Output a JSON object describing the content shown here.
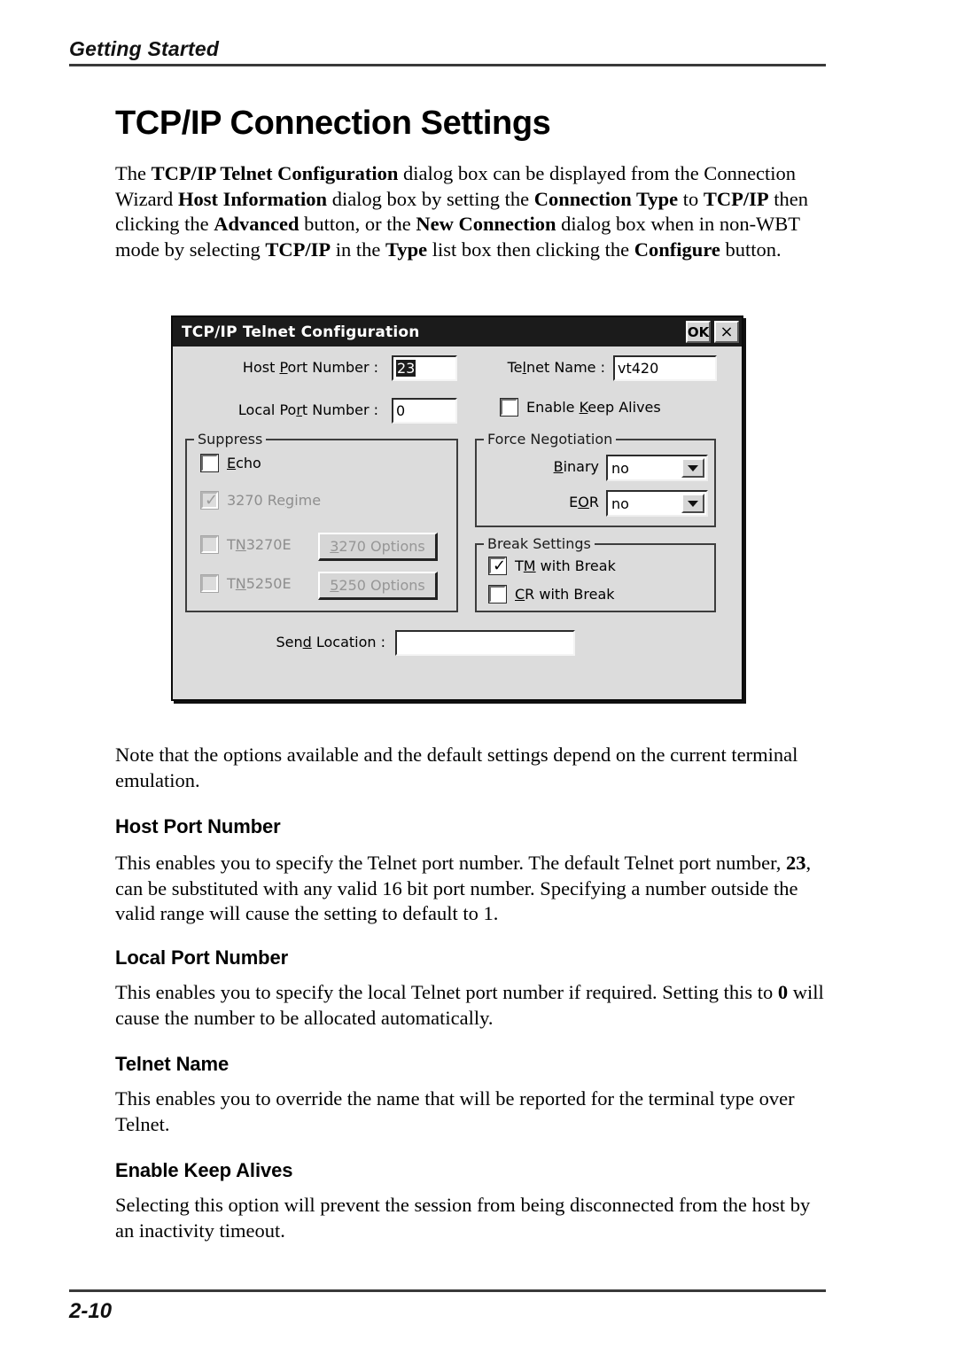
{
  "running_head": "Getting Started",
  "page_title": "TCP/IP Connection Settings",
  "intro_paragraph": {
    "part1": "The ",
    "b1": "TCP/IP Telnet Configuration",
    "part2": " dialog box can be displayed from the Connection Wizard ",
    "b2": "Host Information",
    "part3": " dialog box by setting the ",
    "b3": "Connection Type",
    "part4": " to ",
    "b4": "TCP/IP",
    "part5": " then clicking the ",
    "b5": "Advanced",
    "part6": " button, or the ",
    "b6": "New Connection",
    "part7": " dialog box when in non-WBT mode by selecting ",
    "b7": "TCP/IP",
    "part8": " in the ",
    "b8": "Type",
    "part9": " list box then clicking the ",
    "b9": "Configure",
    "part10": " button."
  },
  "dialog": {
    "title": "TCP/IP Telnet Configuration",
    "ok_label": "OK",
    "close_label": "×",
    "host_port": {
      "label_pre": "Host ",
      "label_key": "P",
      "label_post": "ort Number :",
      "value": "23",
      "selected": true
    },
    "local_port": {
      "label_pre": "Local Po",
      "label_key": "r",
      "label_post": "t Number :",
      "value": "0"
    },
    "telnet_name": {
      "label_pre": "Te",
      "label_key": "l",
      "label_post": "net Name :",
      "value": "vt420"
    },
    "enable_keep_alives": {
      "label_pre": "Enable ",
      "label_key": "K",
      "label_post": "eep Alives",
      "checked": false
    },
    "suppress_group": {
      "title": "Suppress",
      "items": [
        {
          "label_pre": "",
          "label_key": "E",
          "label_post": "cho",
          "checked": false,
          "disabled": false
        },
        {
          "label_pre": "3270 Re",
          "label_key": "g",
          "label_post": "ime",
          "checked": true,
          "disabled": true
        },
        {
          "label_pre": "T",
          "label_key": "N",
          "label_post": "3270E",
          "checked": false,
          "disabled": true
        },
        {
          "label_pre": "T",
          "label_key": "N",
          "label_post": "5250E",
          "checked": false,
          "disabled": true
        }
      ],
      "buttons": [
        {
          "label_key": "3",
          "label_post": "270 Options",
          "disabled": true
        },
        {
          "label_key": "5",
          "label_post": "250 Options",
          "disabled": true
        }
      ]
    },
    "force_negotiation_group": {
      "title": "Force Negotiation",
      "rows": [
        {
          "label_pre": "",
          "label_key": "B",
          "label_post": "inary",
          "value": "no"
        },
        {
          "label_pre": "E",
          "label_key": "O",
          "label_post": "R",
          "value": "no"
        }
      ]
    },
    "break_settings_group": {
      "title": "Break Settings",
      "items": [
        {
          "label_pre": "T",
          "label_key": "M",
          "label_post": " with Break",
          "checked": true
        },
        {
          "label_pre": "",
          "label_key": "C",
          "label_post": "R with Break",
          "checked": false
        }
      ]
    },
    "send_location": {
      "label_pre": "Sen",
      "label_key": "d",
      "label_post": " Location :",
      "value": ""
    }
  },
  "note_paragraph": "Note that the options available and the default settings depend on the current terminal emulation.",
  "sections": [
    {
      "heading": "Host Port Number",
      "p_part1": "This enables you to specify the Telnet port number. The default Telnet port number, ",
      "p_bold": "23",
      "p_part2": ", can be substituted with any valid 16 bit port number. Specifying a number outside the valid range will cause the setting to default to 1."
    },
    {
      "heading": "Local Port Number",
      "p_part1": "This enables you to specify the local Telnet port number if required. Setting this to ",
      "p_bold": "0",
      "p_part2": " will cause the number to be allocated automatically."
    },
    {
      "heading": "Telnet Name",
      "p_part1": "This enables you to override the name that will be reported for the terminal type over Telnet.",
      "p_bold": "",
      "p_part2": ""
    },
    {
      "heading": "Enable Keep Alives",
      "p_part1": "Selecting this option will prevent the session from being disconnected from the host by an inactivity timeout.",
      "p_bold": "",
      "p_part2": ""
    }
  ],
  "page_number": "2-10",
  "colors": {
    "rule": "#3a3a3a",
    "dialog_face": "#dcdcdc",
    "titlebar": "#1b1b1b",
    "disabled_text": "#969696"
  }
}
